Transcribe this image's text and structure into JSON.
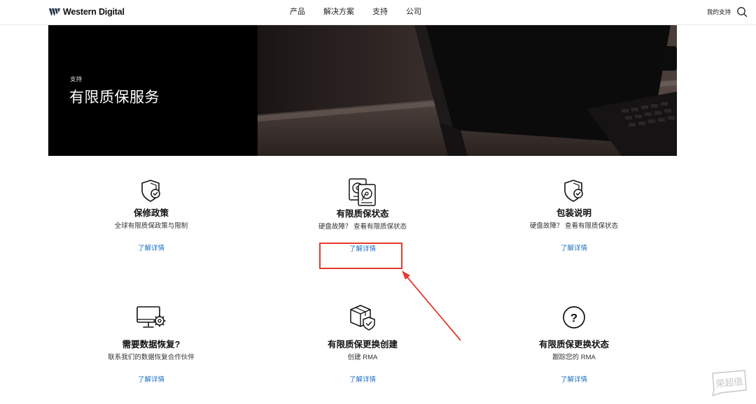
{
  "header": {
    "logo_text": "Western Digital",
    "nav": [
      "产品",
      "解决方案",
      "支持",
      "公司"
    ],
    "my_support": "我的支持"
  },
  "hero": {
    "eyebrow": "支持",
    "title": "有限质保服务"
  },
  "cards": [
    {
      "title": "保修政策",
      "desc": "全球有限质保政策与限制",
      "link": "了解详情",
      "icon": "shield-check-icon"
    },
    {
      "title": "有限质保状态",
      "desc": "硬盘故障？ 查看有限质保状态",
      "link": "了解详情",
      "icon": "hard-drives-icon"
    },
    {
      "title": "包装说明",
      "desc": "硬盘故障？ 查看有限质保状态",
      "link": "了解详情",
      "icon": "shield-check-icon"
    },
    {
      "title": "需要数据恢复?",
      "desc": "联系我们的数据恢复合作伙伴",
      "link": "了解详情",
      "icon": "monitor-gear-icon"
    },
    {
      "title": "有限质保更换创建",
      "desc": "创建 RMA",
      "link": "了解详情",
      "icon": "box-shield-icon"
    },
    {
      "title": "有限质保更换状态",
      "desc": "跟踪您的 RMA",
      "link": "了解详情",
      "icon": "question-circle-icon"
    }
  ],
  "colors": {
    "accent_link": "#1a6fc4",
    "highlight": "#e53a2e",
    "hero_bg": "#000000"
  },
  "watermark_text": "荣超值"
}
